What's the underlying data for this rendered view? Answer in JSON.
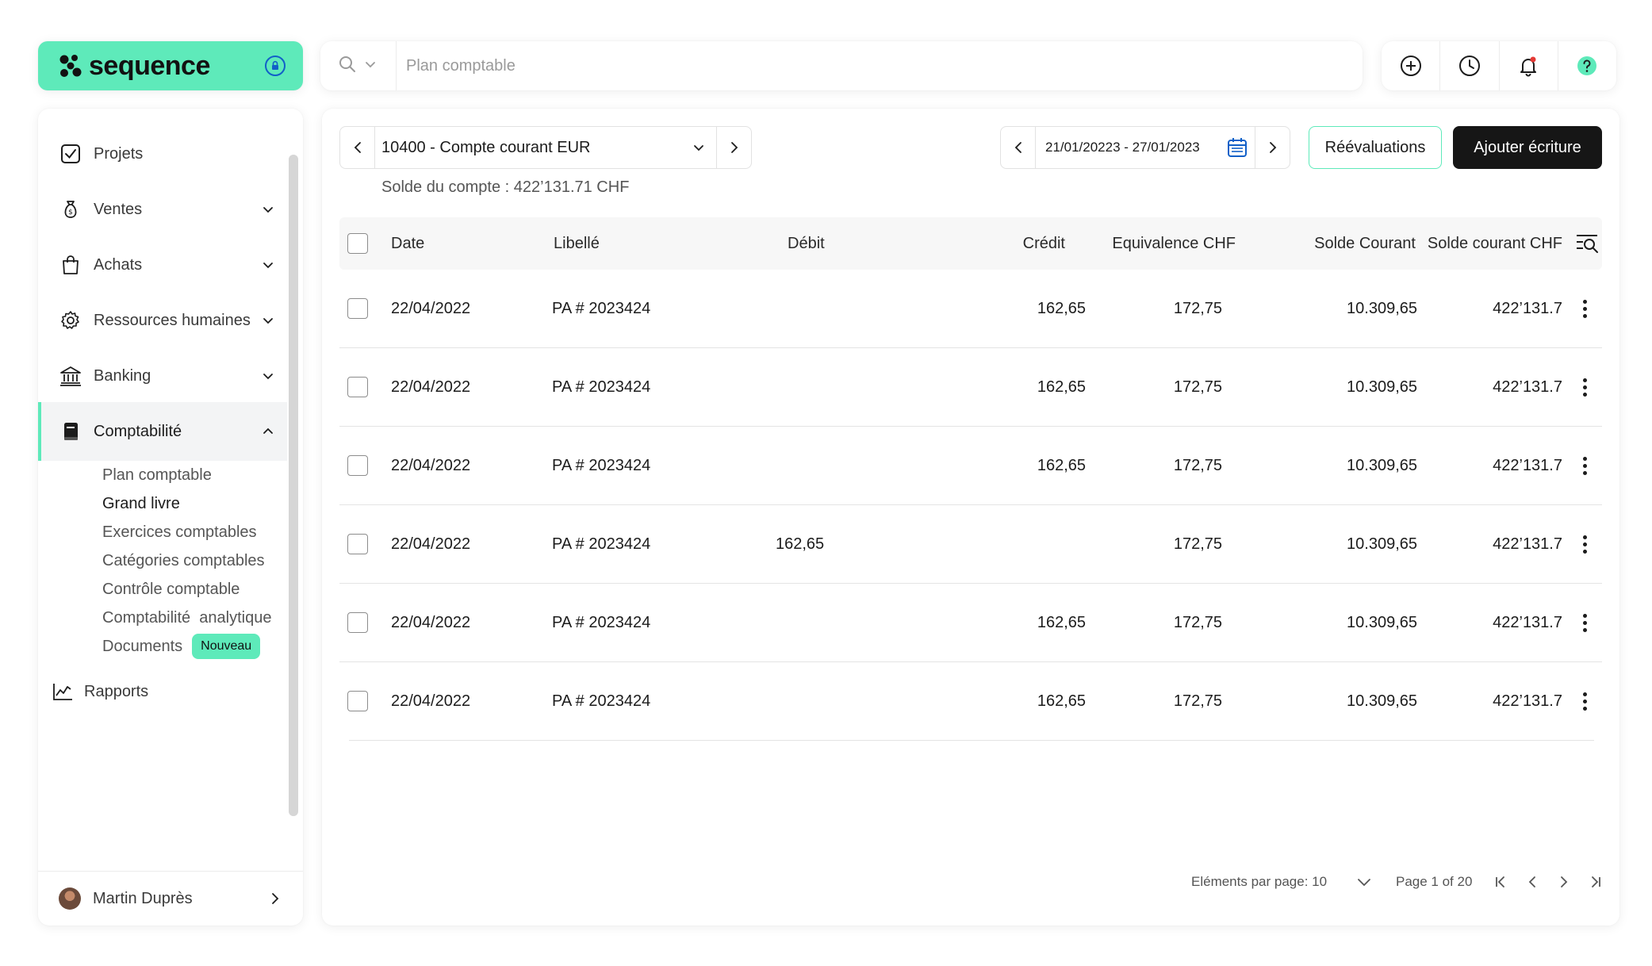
{
  "brand": {
    "name": "sequence",
    "accent": "#5eeaba"
  },
  "search": {
    "placeholder": "Plan comptable"
  },
  "sidebar": {
    "items": [
      {
        "label": "Projets"
      },
      {
        "label": "Ventes"
      },
      {
        "label": "Achats"
      },
      {
        "label": "Ressources humaines"
      },
      {
        "label": "Banking"
      },
      {
        "label": "Comptabilité"
      }
    ],
    "sub_items": [
      "Plan comptable",
      "Grand livre",
      "Exercices comptables",
      "Catégories comptables",
      "Contrôle comptable",
      "Comptabilité  analytique",
      "Documents"
    ],
    "badge": "Nouveau",
    "reports": "Rapports",
    "user": "Martin Duprès"
  },
  "toolbar": {
    "account": "10400 - Compte courant EUR",
    "balance": "Solde du compte : 422’131.71 CHF",
    "date_range": "21/01/20223 - 27/01/2023",
    "reval_label": "Réévaluations",
    "add_label": "Ajouter écriture"
  },
  "table": {
    "headers": [
      "Date",
      "Libellé",
      "Débit",
      "Crédit",
      "Equivalence CHF",
      "Solde Courant",
      "Solde courant CHF"
    ],
    "rows": [
      {
        "date": "22/04/2022",
        "label": "PA # 2023424",
        "debit": "",
        "credit": "162,65",
        "equiv": "172,75",
        "solde": "10.309,65",
        "solde_chf": "422’131.7"
      },
      {
        "date": "22/04/2022",
        "label": "PA # 2023424",
        "debit": "",
        "credit": "162,65",
        "equiv": "172,75",
        "solde": "10.309,65",
        "solde_chf": "422’131.7"
      },
      {
        "date": "22/04/2022",
        "label": "PA # 2023424",
        "debit": "",
        "credit": "162,65",
        "equiv": "172,75",
        "solde": "10.309,65",
        "solde_chf": "422’131.7"
      },
      {
        "date": "22/04/2022",
        "label": "PA # 2023424",
        "debit": "162,65",
        "credit": "",
        "equiv": "172,75",
        "solde": "10.309,65",
        "solde_chf": "422’131.7"
      },
      {
        "date": "22/04/2022",
        "label": "PA # 2023424",
        "debit": "",
        "credit": "162,65",
        "equiv": "172,75",
        "solde": "10.309,65",
        "solde_chf": "422’131.7"
      },
      {
        "date": "22/04/2022",
        "label": "PA # 2023424",
        "debit": "",
        "credit": "162,65",
        "equiv": "172,75",
        "solde": "10.309,65",
        "solde_chf": "422’131.7"
      }
    ]
  },
  "pagination": {
    "per_page": "Eléments par page: 10",
    "page_info": "Page 1 of 20"
  }
}
